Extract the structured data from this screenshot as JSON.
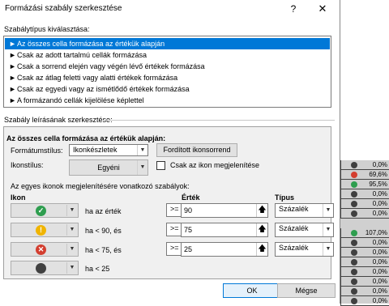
{
  "dialog": {
    "title": "Formázási szabály szerkesztése",
    "help": "?",
    "close": "✕"
  },
  "type_section": {
    "label": "Szabálytípus kiválasztása:",
    "items": [
      "Az összes cella formázása az értékük alapján",
      "Csak az adott tartalmú cellák formázása",
      "Csak a sorrend elején vagy végén lévő értékek formázása",
      "Csak az átlag feletti vagy alatti értékek formázása",
      "Csak az egyedi vagy az ismétlődő értékek formázása",
      "A formázandó cellák kijelölése képlettel"
    ],
    "arrow": "►"
  },
  "desc_section": {
    "label": "Szabály leírásának szerkesztése:",
    "title": "Az összes cella formázása az értékük alapján:",
    "format_style_label": "Formátumstílus:",
    "format_style_value": "Ikonkészletek",
    "reverse_button": "Fordított ikonsorrend",
    "icon_style_label": "Ikonstílus:",
    "icon_style_value": "Egyéni",
    "show_icon_only_label": "Csak az ikon megjelenítése",
    "rules_caption": "Az egyes ikonok megjelenítésére vonatkozó szabályok:",
    "col_icon": "Ikon",
    "col_value": "Érték",
    "col_type": "Típus",
    "rows": [
      {
        "cond": "ha az érték",
        "op": ">=",
        "value": "90",
        "type": "Százalék",
        "color": "#2e9e4f",
        "glyph": "✓"
      },
      {
        "cond": "ha < 90, és",
        "op": ">=",
        "value": "75",
        "type": "Százalék",
        "color": "#f0b400",
        "glyph": "!"
      },
      {
        "cond": "ha < 75, és",
        "op": ">=",
        "value": "25",
        "type": "Százalék",
        "color": "#d33e2f",
        "glyph": "✕"
      },
      {
        "cond": "ha < 25",
        "color": "#404040",
        "glyph": ""
      }
    ]
  },
  "buttons": {
    "ok": "OK",
    "cancel": "Mégse"
  },
  "sheet": {
    "rows": [
      {
        "value": "0,0%",
        "color": "#404040"
      },
      {
        "value": "69,6%",
        "color": "#d33e2f"
      },
      {
        "value": "95,5%",
        "color": "#2e9e4f"
      },
      {
        "value": "0,0%",
        "color": "#404040"
      },
      {
        "value": "0,0%",
        "color": "#404040"
      },
      {
        "value": "0,0%",
        "color": "#404040"
      },
      {
        "value": "107,0%",
        "color": "#2e9e4f"
      },
      {
        "value": "0,0%",
        "color": "#404040"
      },
      {
        "value": "0,0%",
        "color": "#404040"
      },
      {
        "value": "0,0%",
        "color": "#404040"
      },
      {
        "value": "0,0%",
        "color": "#404040"
      },
      {
        "value": "0,0%",
        "color": "#404040"
      },
      {
        "value": "0,0%",
        "color": "#404040"
      },
      {
        "value": "0,0%",
        "color": "#404040"
      }
    ]
  }
}
